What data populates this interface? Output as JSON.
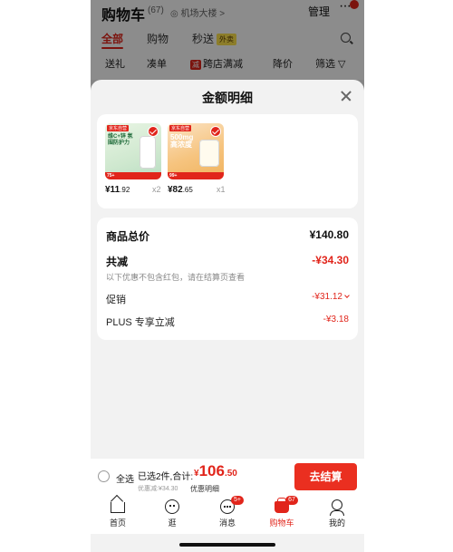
{
  "background": {
    "title": "购物车",
    "count": "(67)",
    "location": "◎ 机场大楼 >",
    "manage": "管理",
    "more": "···",
    "tabs": [
      {
        "label": "全部"
      },
      {
        "label": "购物"
      },
      {
        "label": "秒送"
      }
    ],
    "tab_tag": "外卖",
    "filters": [
      "送礼",
      "凑单",
      "跨店满减",
      "降价",
      "筛选 ▽"
    ],
    "filter_badge": "减"
  },
  "sheet": {
    "title": "金额明细",
    "products": [
      {
        "price_int": "¥11",
        "price_dec": ".92",
        "qty": "x2",
        "tag": "京东自营",
        "text": "维C+锌 氛围防护力",
        "badge": "75+"
      },
      {
        "price_int": "¥82",
        "price_dec": ".65",
        "qty": "x1",
        "tag": "京东自营",
        "text": "500mg 高浓度",
        "badge": "99+"
      }
    ],
    "summary": {
      "total_label": "商品总价",
      "total_value": "¥140.80",
      "discount_label": "共减",
      "discount_value": "-¥34.30",
      "note": "以下优惠不包含红包，请在结算页查看",
      "promo_label": "促销",
      "promo_value": "-¥31.12",
      "plus_label": "PLUS 专享立减",
      "plus_value": "-¥3.18"
    }
  },
  "checkout": {
    "select_all": "全选",
    "selected": "已选2件,合计:",
    "currency": "¥",
    "amount_int": "106",
    "amount_dec": ".50",
    "discount": "优惠减:¥34.30",
    "detail": "优惠明细",
    "pay_button": "去结算"
  },
  "tabbar": [
    {
      "label": "首页",
      "icon": "home-icon"
    },
    {
      "label": "逛",
      "icon": "explore-icon"
    },
    {
      "label": "消息",
      "icon": "message-icon",
      "badge": "5+"
    },
    {
      "label": "购物车",
      "icon": "cart-icon",
      "badge": "67"
    },
    {
      "label": "我的",
      "icon": "profile-icon"
    }
  ],
  "colors": {
    "accent": "#e1251b",
    "pay_button": "#ea2f20"
  }
}
